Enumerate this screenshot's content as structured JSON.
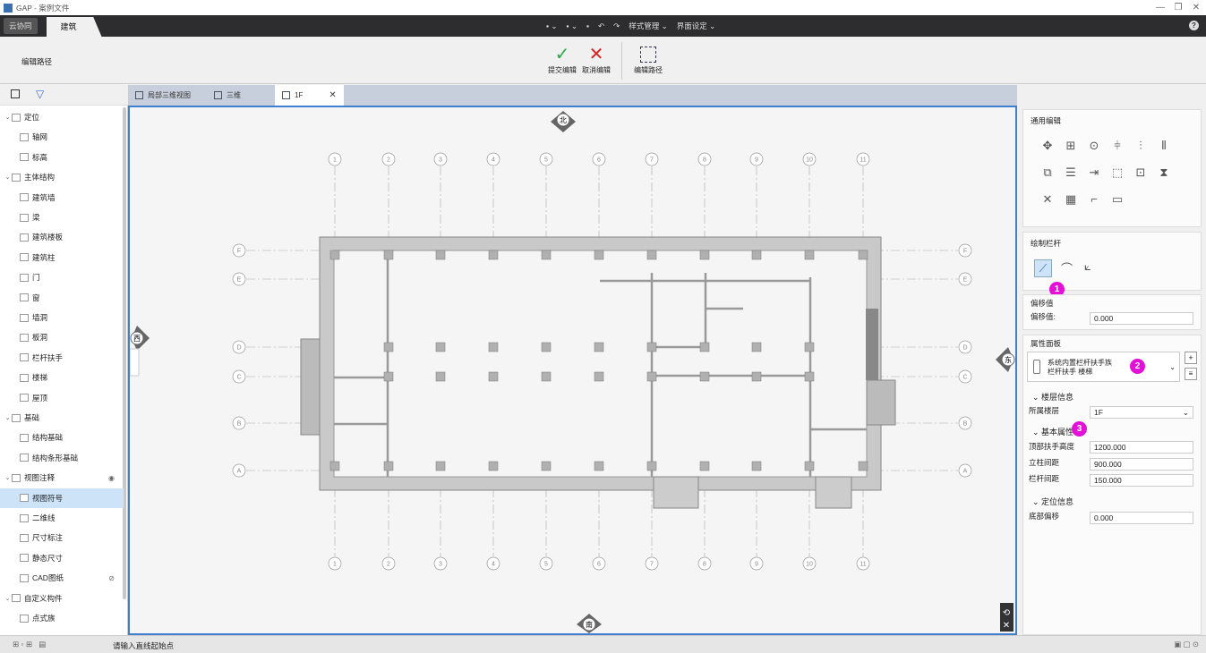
{
  "window": {
    "title": "GAP - 案例文件",
    "min": "—",
    "restore": "❐",
    "close": "✕"
  },
  "tabs": {
    "collab": "云协同",
    "build": "建筑"
  },
  "qat": {
    "new": "▪ ⌄",
    "tools": "▪ ⌄",
    "save": "▪",
    "undo": "↶",
    "redo": "↷",
    "style": "样式管理 ⌄",
    "ui": "界面设定 ⌄"
  },
  "ribbon": {
    "mode_label": "编辑路径",
    "submit": "提交编辑",
    "cancel": "取消编辑",
    "edit_path": "编辑路径",
    "submit_icon": "✓",
    "cancel_icon": "✕"
  },
  "doc_tabs": [
    {
      "label": "局部三维视图"
    },
    {
      "label": "三维"
    },
    {
      "label": "1F"
    }
  ],
  "tree": [
    {
      "label": "定位",
      "level": 0,
      "expanded": true
    },
    {
      "label": "轴网",
      "level": 1
    },
    {
      "label": "标高",
      "level": 1
    },
    {
      "label": "主体结构",
      "level": 0,
      "expanded": true
    },
    {
      "label": "建筑墙",
      "level": 1
    },
    {
      "label": "梁",
      "level": 1
    },
    {
      "label": "建筑楼板",
      "level": 1
    },
    {
      "label": "建筑柱",
      "level": 1
    },
    {
      "label": "门",
      "level": 1
    },
    {
      "label": "窗",
      "level": 1
    },
    {
      "label": "墙洞",
      "level": 1
    },
    {
      "label": "板洞",
      "level": 1
    },
    {
      "label": "栏杆扶手",
      "level": 1
    },
    {
      "label": "楼梯",
      "level": 1
    },
    {
      "label": "屋顶",
      "level": 1
    },
    {
      "label": "基础",
      "level": 0,
      "expanded": true
    },
    {
      "label": "结构基础",
      "level": 1
    },
    {
      "label": "结构条形基础",
      "level": 1
    },
    {
      "label": "视图注释",
      "level": 0,
      "expanded": true
    },
    {
      "label": "视图符号",
      "level": 1,
      "selected": true
    },
    {
      "label": "二维线",
      "level": 1
    },
    {
      "label": "尺寸标注",
      "level": 1
    },
    {
      "label": "静态尺寸",
      "level": 1
    },
    {
      "label": "CAD图纸",
      "level": 1
    },
    {
      "label": "自定义构件",
      "level": 0,
      "expanded": true
    },
    {
      "label": "点式族",
      "level": 1
    }
  ],
  "view": {
    "north": "北",
    "south": "南",
    "west": "西",
    "east": "东",
    "top_grid": [
      "1",
      "2",
      "3",
      "4",
      "5",
      "6",
      "7",
      "8",
      "9",
      "10",
      "11"
    ],
    "side_grid": [
      "F",
      "E",
      "D",
      "C",
      "B",
      "A"
    ]
  },
  "right": {
    "common_edit": "通用编辑",
    "draw_rail": "绘制栏杆",
    "offset_title": "偏移值",
    "offset_label": "偏移值:",
    "offset_value": "0.000",
    "prop_panel": "属性面板",
    "family_line1": "系统内置栏杆扶手族",
    "family_line2": "栏杆扶手 楼梯",
    "floor_section": "楼层信息",
    "floor_label": "所属楼层",
    "floor_value": "1F",
    "basic_section": "基本属性",
    "top_height_label": "顶部扶手高度",
    "top_height_value": "1200.000",
    "post_spacing_label": "立柱间距",
    "post_spacing_value": "900.000",
    "baluster_spacing_label": "栏杆间距",
    "baluster_spacing_value": "150.000",
    "loc_section": "定位信息",
    "bottom_offset_label": "底部偏移",
    "bottom_offset_value": "0.000",
    "badges": [
      "1",
      "2",
      "3"
    ]
  },
  "status": {
    "prompt": "请输入直线起始点"
  }
}
